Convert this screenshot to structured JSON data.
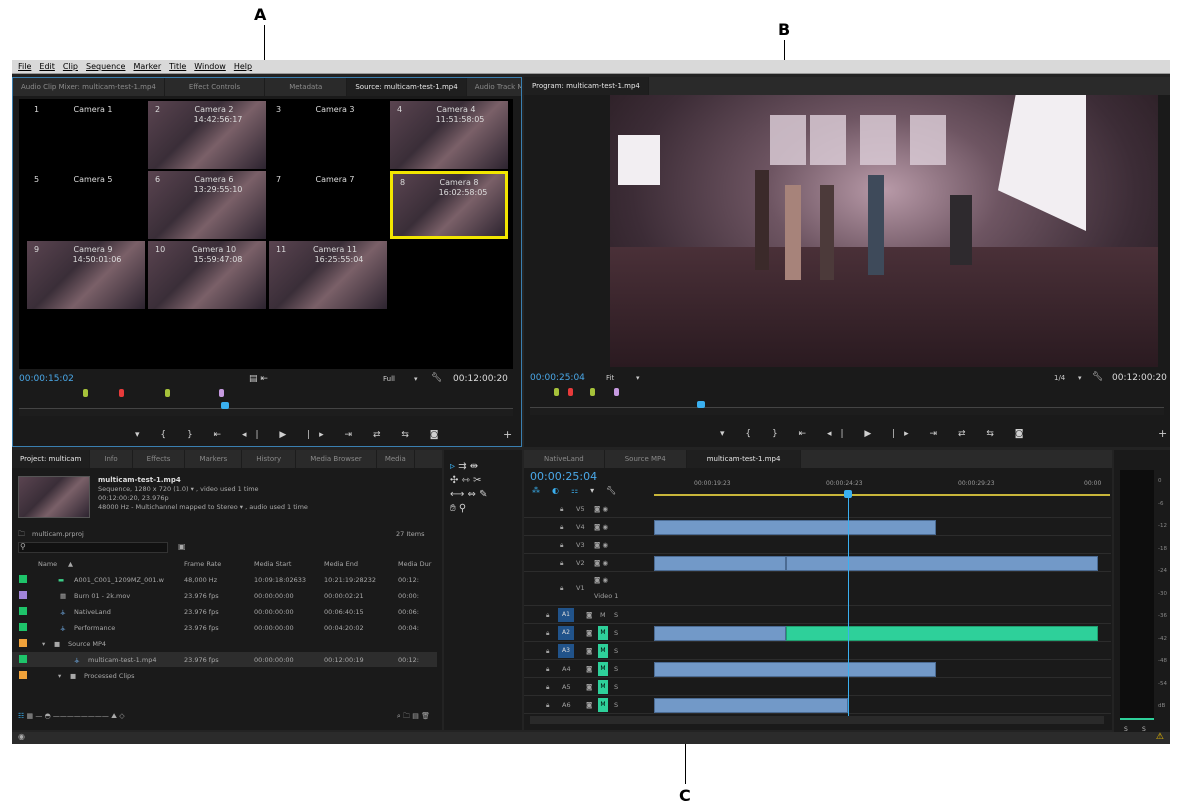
{
  "callouts": {
    "a": "A",
    "b": "B",
    "c": "C"
  },
  "menu": [
    "File",
    "Edit",
    "Clip",
    "Sequence",
    "Marker",
    "Title",
    "Window",
    "Help"
  ],
  "source_panel": {
    "tabs": [
      "Audio Clip Mixer: multicam-test-1.mp4",
      "Effect Controls",
      "Metadata",
      "Source: multicam-test-1.mp4",
      "Audio Track M"
    ],
    "cameras": [
      {
        "num": "1",
        "name": "Camera 1",
        "tc": ""
      },
      {
        "num": "2",
        "name": "Camera 2",
        "tc": "14:42:56:17"
      },
      {
        "num": "3",
        "name": "Camera 3",
        "tc": ""
      },
      {
        "num": "4",
        "name": "Camera 4",
        "tc": "11:51:58:05"
      },
      {
        "num": "5",
        "name": "Camera 5",
        "tc": ""
      },
      {
        "num": "6",
        "name": "Camera 6",
        "tc": "13:29:55:10"
      },
      {
        "num": "7",
        "name": "Camera 7",
        "tc": ""
      },
      {
        "num": "8",
        "name": "Camera 8",
        "tc": "16:02:58:05"
      },
      {
        "num": "9",
        "name": "Camera 9",
        "tc": "14:50:01:06"
      },
      {
        "num": "10",
        "name": "Camera 10",
        "tc": "15:59:47:08"
      },
      {
        "num": "11",
        "name": "Camera 11",
        "tc": "16:25:55:04"
      }
    ],
    "timecode": "00:00:15:02",
    "zoom": "Full",
    "duration": "00:12:00:20"
  },
  "program_panel": {
    "tab": "Program: multicam-test-1.mp4",
    "timecode": "00:00:25:04",
    "fit": "Fit",
    "res": "1/4",
    "duration": "00:12:00:20"
  },
  "project_panel": {
    "tabs": [
      "Project: multicam",
      "Info",
      "Effects",
      "Markers",
      "History",
      "Media Browser",
      "Media"
    ],
    "clip_name": "multicam-test-1.mp4",
    "clip_line1": "Sequence, 1280 x 720 (1.0)",
    "clip_line1_suffix": ", video used 1 time",
    "clip_line2": "00:12:00:20, 23.976p",
    "clip_line3": "48000 Hz - Multichannel mapped to Stereo",
    "clip_line3_suffix": ", audio used 1 time",
    "project_file": "multicam.prproj",
    "item_count": "27 Items",
    "columns": [
      "Name",
      "Frame Rate",
      "Media Start",
      "Media End",
      "Media Dur"
    ],
    "rows": [
      {
        "name": "A001_C001_1209MZ_001.w",
        "rate": "48,000 Hz",
        "start": "10:09:18:02633",
        "end": "10:21:19:28232",
        "dur": "00:12:",
        "color": "#1ec46a"
      },
      {
        "name": "Burn 01 - 2k.mov",
        "rate": "23.976 fps",
        "start": "00:00:00:00",
        "end": "00:00:02:21",
        "dur": "00:00:",
        "color": "#a184d9"
      },
      {
        "name": "NativeLand",
        "rate": "23.976 fps",
        "start": "00:00:00:00",
        "end": "00:06:40:15",
        "dur": "00:06:",
        "color": "#1ec46a"
      },
      {
        "name": "Performance",
        "rate": "23.976 fps",
        "start": "00:00:00:00",
        "end": "00:04:20:02",
        "dur": "00:04:",
        "color": "#1ec46a"
      },
      {
        "name": "Source MP4",
        "rate": "",
        "start": "",
        "end": "",
        "dur": "",
        "color": "#f0a23a"
      },
      {
        "name": "multicam-test-1.mp4",
        "rate": "23.976 fps",
        "start": "00:00:00:00",
        "end": "00:12:00:19",
        "dur": "00:12:",
        "color": "#1ec46a"
      },
      {
        "name": "Processed Clips",
        "rate": "",
        "start": "",
        "end": "",
        "dur": "",
        "color": "#f0a23a"
      }
    ]
  },
  "timeline_panel": {
    "tabs": [
      "NativeLand",
      "Source MP4",
      "multicam-test-1.mp4"
    ],
    "timecode": "00:00:25:04",
    "ruler": [
      "00:00:19:23",
      "00:00:24:23",
      "00:00:29:23",
      "00:00"
    ],
    "tracks": [
      {
        "name": "V5"
      },
      {
        "name": "V4"
      },
      {
        "name": "V3"
      },
      {
        "name": "V2"
      },
      {
        "name": "V1",
        "sub": "Video 1"
      },
      {
        "name": "A1"
      },
      {
        "name": "A2"
      },
      {
        "name": "A3"
      },
      {
        "name": "A4"
      },
      {
        "name": "A5"
      },
      {
        "name": "A6"
      }
    ],
    "track_flag_m": "M",
    "track_flag_s": "S"
  },
  "meter": {
    "scale": [
      "0",
      "-6",
      "-12",
      "-18",
      "-24",
      "-30",
      "-36",
      "-42",
      "-48",
      "-54",
      "dB"
    ],
    "s1": "S",
    "s2": "S"
  }
}
